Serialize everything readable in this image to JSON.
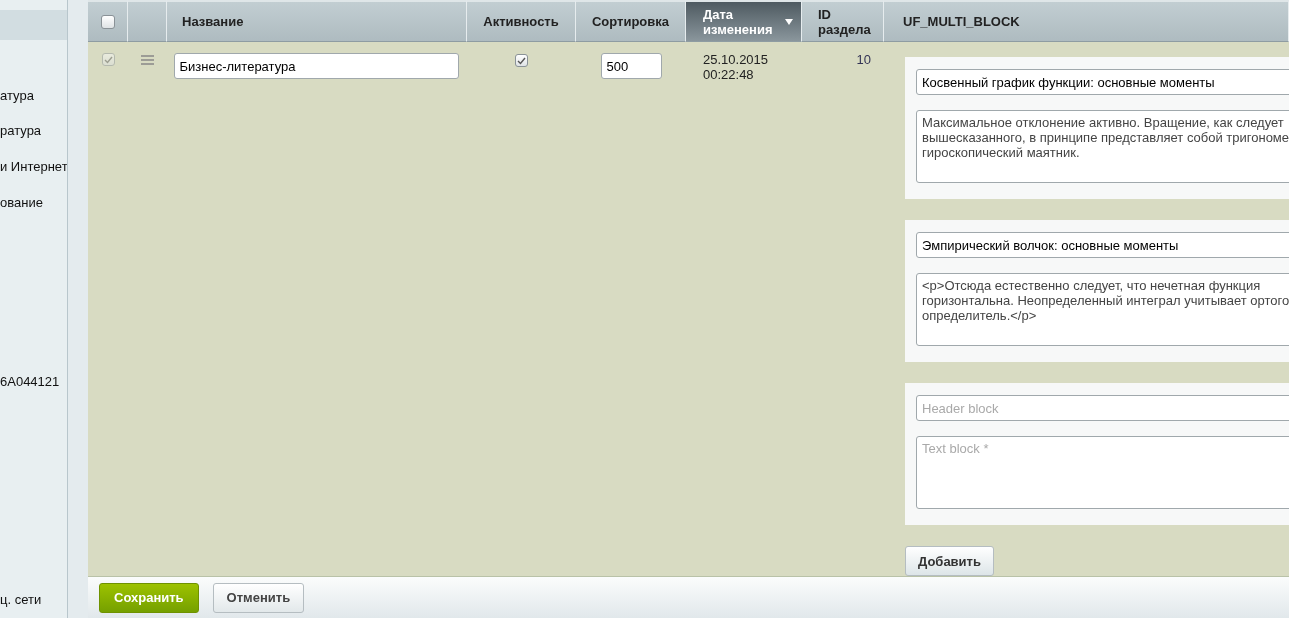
{
  "sidebar": {
    "items": [
      {
        "label": "атура"
      },
      {
        "label": "ратура"
      },
      {
        "label": "и Интернет"
      },
      {
        "label": "ование"
      },
      {
        "label": "6A044121"
      },
      {
        "label": "ц. сети"
      }
    ]
  },
  "table": {
    "columns": [
      {
        "kind": "checkbox",
        "checked": false
      },
      {
        "kind": "handle"
      },
      {
        "kind": "text",
        "label": "Название",
        "sorted": false
      },
      {
        "kind": "text",
        "label": "Активность",
        "sorted": false
      },
      {
        "kind": "text",
        "label": "Сортировка",
        "sorted": false
      },
      {
        "kind": "text",
        "label": "Дата изменения",
        "sorted": true
      },
      {
        "kind": "text",
        "label": "ID раздела",
        "sorted": false
      },
      {
        "kind": "text",
        "label": "UF_MULTI_BLOCK",
        "sorted": false
      }
    ],
    "rows": [
      {
        "checked": true,
        "disabled": true,
        "name": "Бизнес-литература",
        "active": true,
        "sort": "500",
        "date": "25.10.2015",
        "time": "00:22:48",
        "section_id": "10",
        "multi_block": {
          "blocks": [
            {
              "header": "Косвенный график функции: основные моменты",
              "text": "Максимальное отклонение активно. Вращение, как следует\nвышесказанного, в принципе представляет собой тригономе\nгироскопический маятник."
            },
            {
              "header": "Эмпирический волчок: основные моменты",
              "text": "<p>Отсюда естественно следует, что нечетная функция\nгоризонтальна. Неопределенный интеграл учитывает ортого\nопределитель.</p>"
            },
            {
              "header_placeholder": "Header block",
              "text_placeholder": "Text block *"
            }
          ],
          "add_button": "Добавить"
        }
      }
    ]
  },
  "footer": {
    "buttons": [
      {
        "label": "Сохранить",
        "kind": "primary"
      },
      {
        "label": "Отменить",
        "kind": "secondary"
      }
    ]
  }
}
